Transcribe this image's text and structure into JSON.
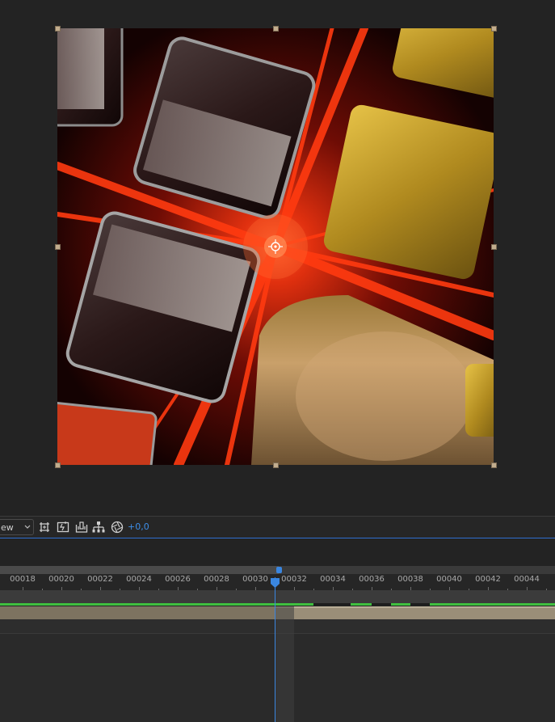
{
  "viewer": {
    "image": "abstract-3d-render-red-light-burst-glass-and-gold-cubes"
  },
  "toolbar": {
    "view_select_label": "ew",
    "icons": [
      "region-of-interest-icon",
      "snapshot-icon",
      "show-channel-icon",
      "resolution-icon",
      "exposure-reset-icon"
    ],
    "exposure_value": "+0,0"
  },
  "timeline": {
    "ruler_labels": [
      "00018",
      "00020",
      "00022",
      "00024",
      "00026",
      "00028",
      "00030",
      "00032",
      "00034",
      "00036",
      "00038",
      "00040",
      "00042",
      "00044"
    ],
    "current_frame_marker": "00031",
    "colors": {
      "accent": "#3a86e0",
      "cache": "#3fbf3f",
      "layer_bar": "#9a8e78"
    }
  }
}
